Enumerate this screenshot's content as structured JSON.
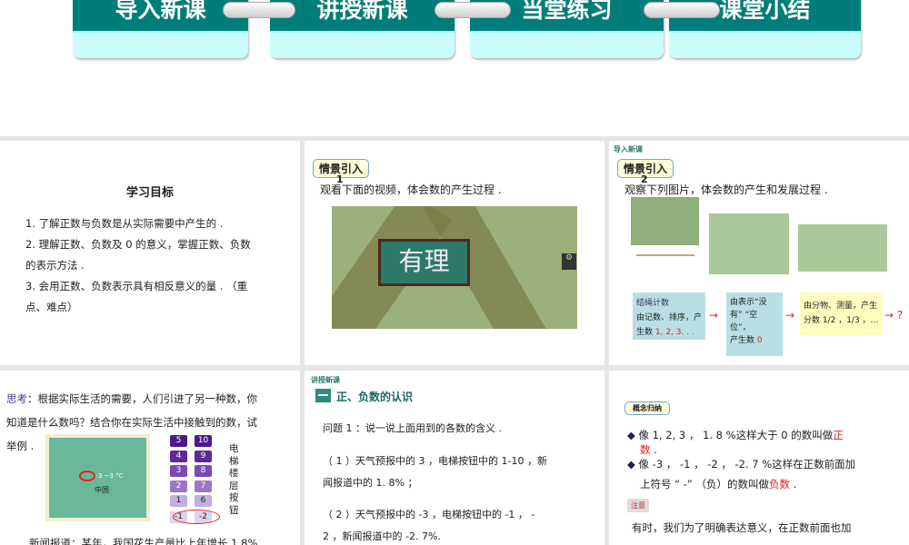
{
  "nav": {
    "items": [
      "导入新课",
      "讲授新课",
      "当堂练习",
      "课堂小结"
    ],
    "color": "#007d78"
  },
  "slide1": {
    "title": "学习目标",
    "lines": [
      "1. 了解正数与负数是从实际需要中产生的 .",
      "2. 理解正数、负数及 0 的意义，掌握正数、负数",
      "的表示方法 .",
      "3. 会用正数、负数表示具有相反意义的量 . （重",
      "点、难点）"
    ]
  },
  "slide2": {
    "tag": "情景引入",
    "num": "1",
    "text": "观看下面的视频，体会数的产生过程 .",
    "video_text": "有理"
  },
  "slide3": {
    "section": "导入新课",
    "tag": "情景引入",
    "num": "2",
    "text": "观察下列图片，体会数的产生和发展过程 .",
    "box1": {
      "title": "结绳计数",
      "l1": "由记数、排序，产",
      "l2": "生数 ",
      "nums": "1, 2, 3. . ."
    },
    "box2": {
      "l1": "由表示“没",
      "l2": "有” “空",
      "l3": "位”，",
      "l4": "产生数 ",
      "num": "0"
    },
    "box3": {
      "l1": "由分物、测量，产生",
      "l2": "分数 1/2 ，1/3 ，…"
    },
    "arrow": "→",
    "q": "?"
  },
  "slide4": {
    "think": "思考",
    "text1": "：根据实际生活的需要，人们引进了另一种数，你",
    "text2": "知道是什么数吗？结合你在实际生活中接触到的数，试",
    "text3": "举例 .",
    "map_label": "中国",
    "map_temp": "−3 ~3 °C",
    "floors": [
      "5",
      "10",
      "4",
      "9",
      "3",
      "8",
      "2",
      "7",
      "1",
      "6",
      "-1",
      "-2"
    ],
    "elevator_label": [
      "电",
      "梯",
      "楼",
      "层",
      "按",
      "钮"
    ],
    "news": "新闻报道：某年，我国花生产量比上年增长 1.8%"
  },
  "slide5": {
    "section": "讲授新课",
    "heading": "正、负数的认识",
    "q": "问题 1 ：说一说上面用到的各数的含义 .",
    "p1a": "（ 1 ）天气预报中的 3 ，电梯按钮中的 1-10 ，新",
    "p1b": "闻报道中的 1. 8% ；",
    "p2a": "（ 2 ）天气预报中的 -3 ，电梯按钮中的 -1 ， -",
    "p2b": "2 ，新闻报道中的 -2. 7%."
  },
  "slide6": {
    "tag": "概念归纳",
    "b1a": "像 1, 2, 3 ， 1. 8 %这样大于 0 的数叫做",
    "b1r": "正",
    "b1b": "数",
    "b2a": "像 -3 ， -1 ， -2 ， -2. 7 %这样在正数前面加",
    "b2b": "上符号 “ -” （负）的数叫做",
    "b2r": "负数",
    "note": "注意",
    "p": "有时，我们为了明确表达意义，在正数前面也加"
  }
}
